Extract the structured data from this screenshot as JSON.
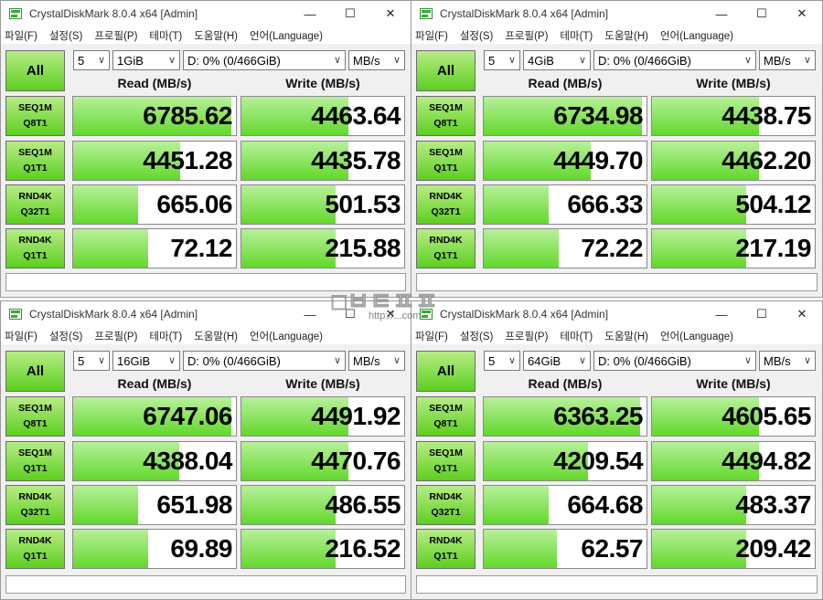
{
  "app": {
    "title": "CrystalDiskMark 8.0.4 x64 [Admin]",
    "menus": [
      "파일(F)",
      "설정(S)",
      "프로필(P)",
      "테마(T)",
      "도움말(H)",
      "언어(Language)"
    ],
    "caption": {
      "min": "—",
      "max": "☐",
      "close": "✕"
    },
    "all_label": "All",
    "read_header": "Read (MB/s)",
    "write_header": "Write (MB/s)",
    "tests": [
      {
        "l1": "SEQ1M",
        "l2": "Q8T1"
      },
      {
        "l1": "SEQ1M",
        "l2": "Q1T1"
      },
      {
        "l1": "RND4K",
        "l2": "Q32T1"
      },
      {
        "l1": "RND4K",
        "l2": "Q1T1"
      }
    ],
    "accent": "#5ccf1e"
  },
  "windows": [
    {
      "count": "5",
      "size": "1GiB",
      "drive": "D: 0% (0/466GiB)",
      "unit": "MB/s",
      "rows": [
        {
          "read": "6785.62",
          "write": "4463.64",
          "read_fill": 0.97,
          "write_fill": 0.66
        },
        {
          "read": "4451.28",
          "write": "4435.78",
          "read_fill": 0.66,
          "write_fill": 0.66
        },
        {
          "read": "665.06",
          "write": "501.53",
          "read_fill": 0.4,
          "write_fill": 0.58
        },
        {
          "read": "72.12",
          "write": "215.88",
          "read_fill": 0.46,
          "write_fill": 0.58
        }
      ]
    },
    {
      "count": "5",
      "size": "4GiB",
      "drive": "D: 0% (0/466GiB)",
      "unit": "MB/s",
      "rows": [
        {
          "read": "6734.98",
          "write": "4438.75",
          "read_fill": 0.97,
          "write_fill": 0.66
        },
        {
          "read": "4449.70",
          "write": "4462.20",
          "read_fill": 0.66,
          "write_fill": 0.66
        },
        {
          "read": "666.33",
          "write": "504.12",
          "read_fill": 0.4,
          "write_fill": 0.58
        },
        {
          "read": "72.22",
          "write": "217.19",
          "read_fill": 0.46,
          "write_fill": 0.58
        }
      ]
    },
    {
      "count": "5",
      "size": "16GiB",
      "drive": "D: 0% (0/466GiB)",
      "unit": "MB/s",
      "rows": [
        {
          "read": "6747.06",
          "write": "4491.92",
          "read_fill": 0.97,
          "write_fill": 0.66
        },
        {
          "read": "4388.04",
          "write": "4470.76",
          "read_fill": 0.65,
          "write_fill": 0.66
        },
        {
          "read": "651.98",
          "write": "486.55",
          "read_fill": 0.4,
          "write_fill": 0.58
        },
        {
          "read": "69.89",
          "write": "216.52",
          "read_fill": 0.46,
          "write_fill": 0.58
        }
      ]
    },
    {
      "count": "5",
      "size": "64GiB",
      "drive": "D: 0% (0/466GiB)",
      "unit": "MB/s",
      "rows": [
        {
          "read": "6363.25",
          "write": "4605.65",
          "read_fill": 0.96,
          "write_fill": 0.66
        },
        {
          "read": "4209.54",
          "write": "4494.82",
          "read_fill": 0.64,
          "write_fill": 0.66
        },
        {
          "read": "664.68",
          "write": "483.37",
          "read_fill": 0.4,
          "write_fill": 0.58
        },
        {
          "read": "62.57",
          "write": "209.42",
          "read_fill": 0.45,
          "write_fill": 0.58
        }
      ]
    }
  ]
}
